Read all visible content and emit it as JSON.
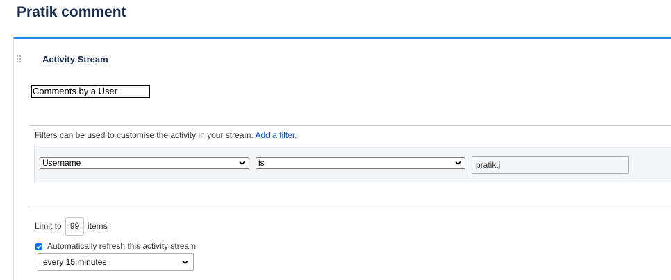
{
  "page": {
    "title": "Pratik comment"
  },
  "gadget": {
    "title": "Activity Stream",
    "title_input_value": "Comments by a User",
    "filters_intro": "Filters can be used to customise the activity in your stream.",
    "add_filter_link": "Add a filter.",
    "filter": {
      "field": "Username",
      "operator": "is",
      "value": "pratik.j"
    },
    "limit": {
      "label": "Limit to",
      "value": "99",
      "suffix": "items"
    },
    "refresh": {
      "checked": true,
      "label": "Automatically refresh this activity stream",
      "interval": "every 15 minutes"
    }
  },
  "colors": {
    "accent_bar": "#2684ff",
    "link": "#0052cc",
    "checkbox": "#0075ff"
  },
  "icons": [
    "drag-handle-icon",
    "chevron-down-icon",
    "checkmark-icon"
  ]
}
